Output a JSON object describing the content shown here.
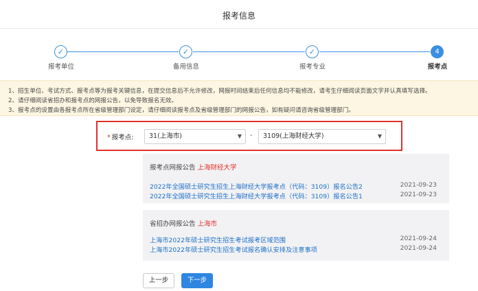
{
  "page": {
    "title": "报考信息"
  },
  "steps": [
    {
      "label": "报考单位",
      "mark": "✓",
      "state": "done"
    },
    {
      "label": "备用信息",
      "mark": "✓",
      "state": "done"
    },
    {
      "label": "报考专业",
      "mark": "✓",
      "state": "done"
    },
    {
      "label": "报考点",
      "mark": "4",
      "state": "active"
    }
  ],
  "notice": {
    "lines": [
      "1、招生单位、考试方式、报考点等为报考关键信息，在提交信息后不允许修改，网报时间结束后任何信息均不能修改，请考生仔细阅读页面文字并认真填写选择。",
      "2、请仔细阅读省招办和报考点的网报公告，以免导致报名无效。",
      "3、报考点的设置由各报考点所在省级管理部门设定，请仔细阅读报考点及省级管理部门的网报公告，如有疑问请咨询省级管理部门。"
    ]
  },
  "selector": {
    "required_mark": "*",
    "label": "报考点:",
    "province_value": "31(上海市)",
    "separator": "-",
    "site_value": "3109(上海财经大学)"
  },
  "site_notices": {
    "heading_prefix": "报考点网报公告",
    "heading_highlight": "上海财经大学",
    "items": [
      {
        "title": "2022年全国硕士研究生招生上海财经大学报考点（代码：3109）报名公告2",
        "date": "2021-09-23"
      },
      {
        "title": "2022年全国硕士研究生招生上海财经大学报考点（代码：3109）报名公告1",
        "date": "2021-09-23"
      }
    ]
  },
  "province_notices": {
    "heading_prefix": "省招办网报公告",
    "heading_highlight": "上海市",
    "items": [
      {
        "title": "上海市2022年硕士研究生招生考试报考区域范围",
        "date": "2021-09-24"
      },
      {
        "title": "上海市2022年硕士研究生招生考试报名确认安排及注意事项",
        "date": "2021-09-24"
      }
    ]
  },
  "actions": {
    "prev_label": "上一步",
    "next_label": "下一步"
  },
  "colors": {
    "accent": "#3b8fe0",
    "highlight": "#e0302a",
    "link": "#1c6fc9",
    "notice_bg": "#fdf6e3"
  }
}
